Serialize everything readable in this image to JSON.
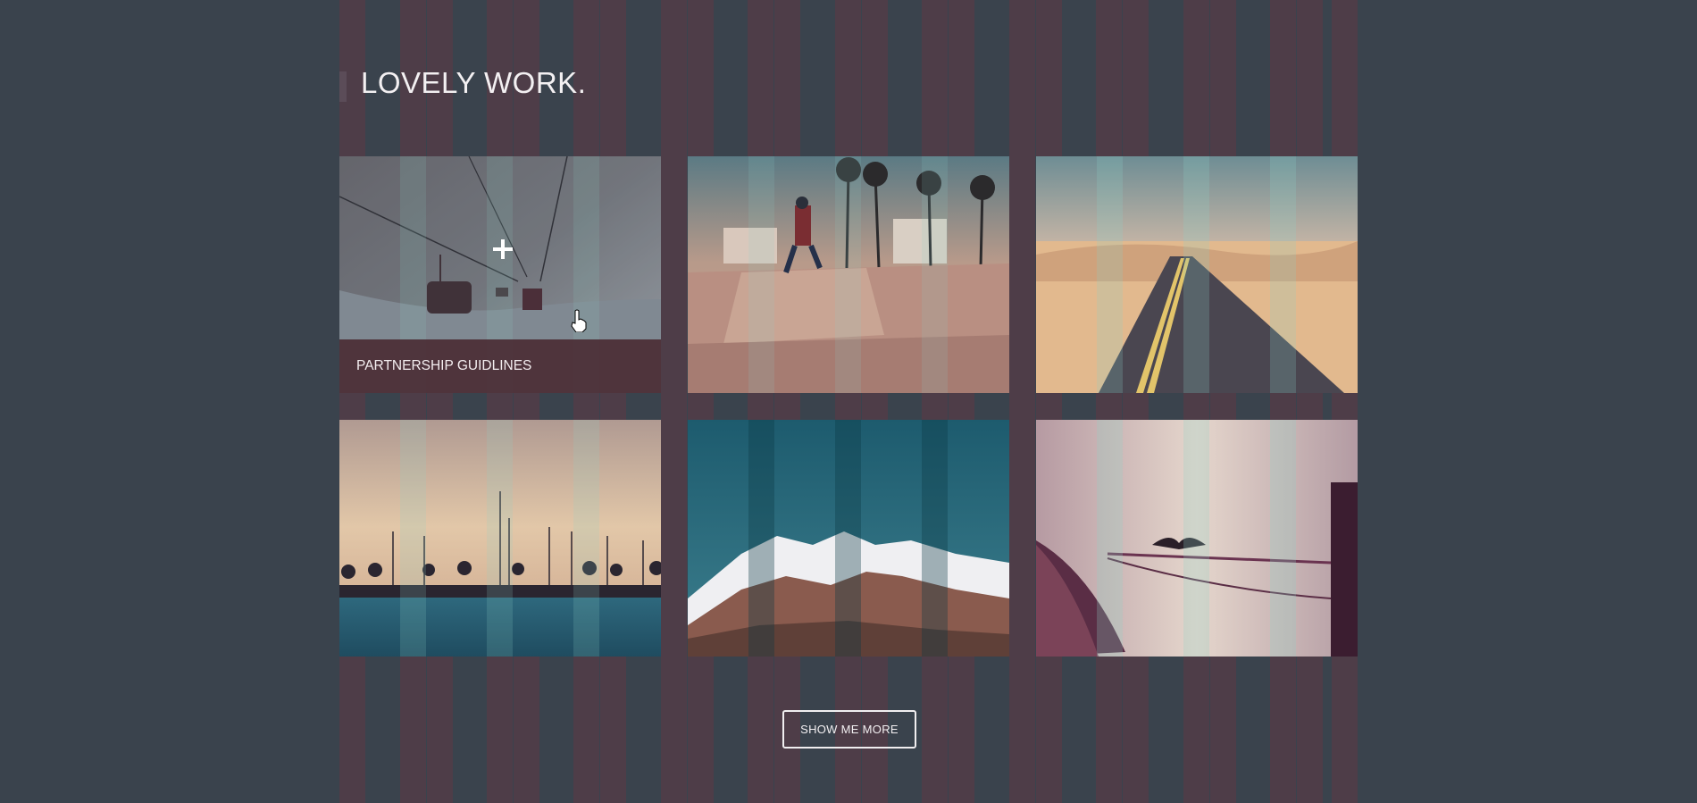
{
  "section": {
    "title": "LOVELY WORK."
  },
  "portfolio": {
    "items": [
      {
        "id": "gondola",
        "caption": "PARTNERSHIP GUIDLINES",
        "hover_icon": "plus-icon"
      },
      {
        "id": "skatepark"
      },
      {
        "id": "desert-road"
      },
      {
        "id": "marina"
      },
      {
        "id": "mountains"
      },
      {
        "id": "cormorant-boat"
      }
    ]
  },
  "buttons": {
    "show_more": "SHOW ME MORE"
  },
  "colors": {
    "background": "#3a434d",
    "grid_column": "#4e3d48",
    "caption_overlay": "#482830",
    "text": "#f3f0f2"
  }
}
